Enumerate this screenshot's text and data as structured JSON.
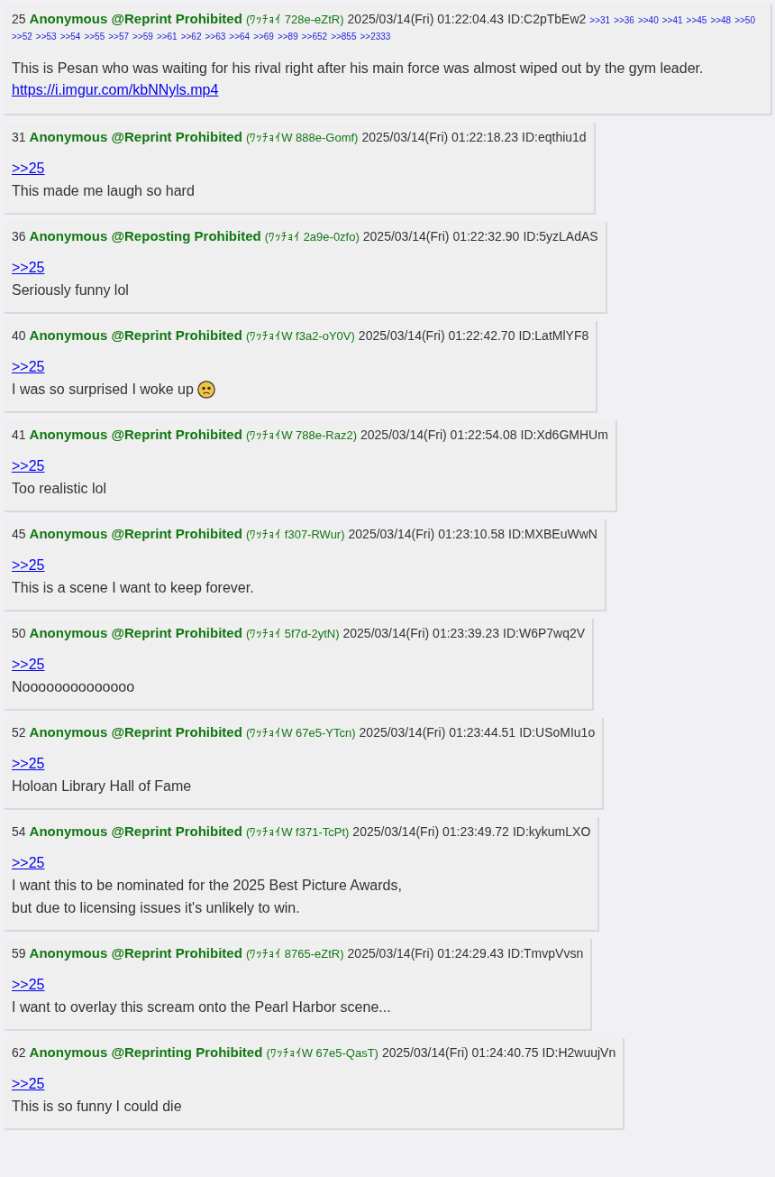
{
  "posts": [
    {
      "number": "25",
      "name": "Anonymous",
      "handle": "@Reprint Prohibited",
      "trip": "(ﾜｯﾁｮｲ 728e-eZtR)",
      "date": "2025/03/14(Fri) 01:22:04.43",
      "id": "ID:C2pTbEw2",
      "backlinks": [
        ">>31",
        ">>36",
        ">>40",
        ">>41",
        ">>45",
        ">>48",
        ">>50",
        ">>52",
        ">>53",
        ">>54",
        ">>55",
        ">>57",
        ">>59",
        ">>61",
        ">>62",
        ">>63",
        ">>64",
        ">>69",
        ">>89",
        ">>652",
        ">>855",
        ">>2333"
      ],
      "body": "This is Pesan who was waiting for his rival right after his main force was almost wiped out by the gym leader.",
      "url": "https://i.imgur.com/kbNNyls.mp4",
      "emoji": false
    },
    {
      "number": "31",
      "name": "Anonymous",
      "handle": "@Reprint Prohibited",
      "trip": "(ﾜｯﾁｮｲW 888e-Gomf)",
      "date": "2025/03/14(Fri) 01:22:18.23",
      "id": "ID:eqthiu1d",
      "reply": ">>25",
      "body": "This made me laugh so hard",
      "emoji": false
    },
    {
      "number": "36",
      "name": "Anonymous",
      "handle": "@Reposting Prohibited",
      "trip": "(ﾜｯﾁｮｲ 2a9e-0zfo)",
      "date": "2025/03/14(Fri) 01:22:32.90",
      "id": "ID:5yzLAdAS",
      "reply": ">>25",
      "body": "Seriously funny lol",
      "emoji": false
    },
    {
      "number": "40",
      "name": "Anonymous",
      "handle": "@Reprint Prohibited",
      "trip": "(ﾜｯﾁｮｲW f3a2-oY0V)",
      "date": "2025/03/14(Fri) 01:22:42.70",
      "id": "ID:LatMlYF8",
      "reply": ">>25",
      "body": "I was so surprised I woke up",
      "emoji": true
    },
    {
      "number": "41",
      "name": "Anonymous",
      "handle": "@Reprint Prohibited",
      "trip": "(ﾜｯﾁｮｲW 788e-Raz2)",
      "date": "2025/03/14(Fri) 01:22:54.08",
      "id": "ID:Xd6GMHUm",
      "reply": ">>25",
      "body": "Too realistic lol",
      "emoji": false
    },
    {
      "number": "45",
      "name": "Anonymous",
      "handle": "@Reprint Prohibited",
      "trip": "(ﾜｯﾁｮｲ f307-RWur)",
      "date": "2025/03/14(Fri) 01:23:10.58",
      "id": "ID:MXBEuWwN",
      "reply": ">>25",
      "body": "This is a scene I want to keep forever.",
      "emoji": false
    },
    {
      "number": "50",
      "name": "Anonymous",
      "handle": "@Reprint Prohibited",
      "trip": "(ﾜｯﾁｮｲ 5f7d-2ytN)",
      "date": "2025/03/14(Fri) 01:23:39.23",
      "id": "ID:W6P7wq2V",
      "reply": ">>25",
      "body": "Noooooooooooooo",
      "emoji": false
    },
    {
      "number": "52",
      "name": "Anonymous",
      "handle": "@Reprint Prohibited",
      "trip": "(ﾜｯﾁｮｲW 67e5-YTcn)",
      "date": "2025/03/14(Fri) 01:23:44.51",
      "id": "ID:USoMIu1o",
      "reply": ">>25",
      "body": "Holoan Library Hall of Fame",
      "emoji": false
    },
    {
      "number": "54",
      "name": "Anonymous",
      "handle": "@Reprint Prohibited",
      "trip": "(ﾜｯﾁｮｲW f371-TcPt)",
      "date": "2025/03/14(Fri) 01:23:49.72",
      "id": "ID:kykumLXO",
      "reply": ">>25",
      "body": "I want this to be nominated for the 2025 Best Picture Awards,\nbut due to licensing issues it's unlikely to win.",
      "emoji": false
    },
    {
      "number": "59",
      "name": "Anonymous",
      "handle": "@Reprint Prohibited",
      "trip": "(ﾜｯﾁｮｲ 8765-eZtR)",
      "date": "2025/03/14(Fri) 01:24:29.43",
      "id": "ID:TmvpVvsn",
      "reply": ">>25",
      "body": "I want to overlay this scream onto the Pearl Harbor scene...",
      "emoji": false
    },
    {
      "number": "62",
      "name": "Anonymous",
      "handle": "@Reprinting Prohibited",
      "trip": "(ﾜｯﾁｮｲW 67e5-QasT)",
      "date": "2025/03/14(Fri) 01:24:40.75",
      "id": "ID:H2wuujVn",
      "reply": ">>25",
      "body": "This is so funny I could die",
      "emoji": false
    }
  ]
}
